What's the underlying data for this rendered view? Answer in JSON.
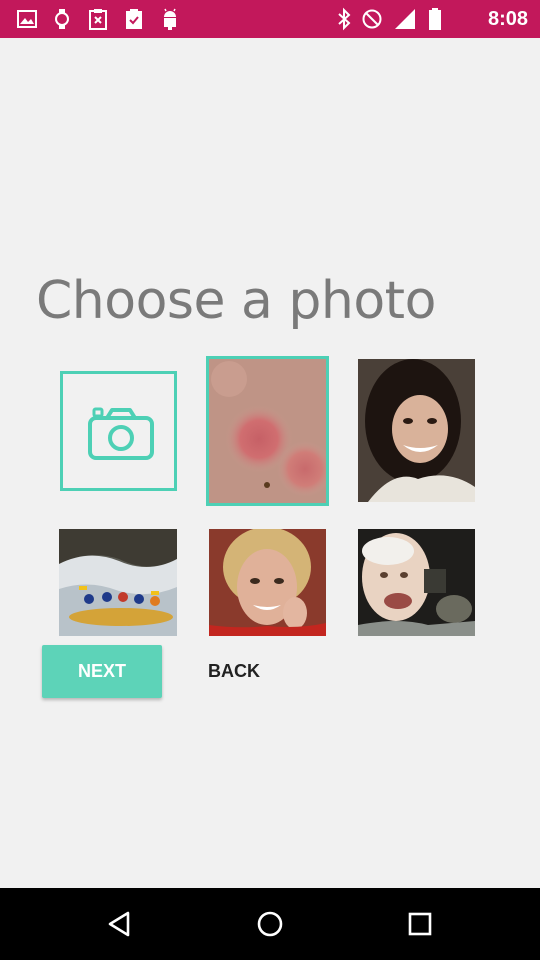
{
  "status_bar": {
    "time": "8:08",
    "color": "#c2185b",
    "left_icons": [
      "gallery-icon",
      "watch-icon",
      "clipboard-x-icon",
      "clipboard-check-icon",
      "android-icon"
    ],
    "right_icons": [
      "bluetooth-icon",
      "do-not-disturb-icon",
      "signal-icon",
      "battery-icon"
    ]
  },
  "main": {
    "title": "Choose a photo",
    "accent_color": "#4dd0b5",
    "photos": [
      {
        "name": "camera-tile",
        "icon": "camera-icon"
      },
      {
        "name": "skin-rash-photo",
        "selected": true
      },
      {
        "name": "smiling-woman-photo"
      },
      {
        "name": "rafting-photo"
      },
      {
        "name": "older-woman-photo"
      },
      {
        "name": "older-man-photo"
      }
    ],
    "next_label": "NEXT",
    "back_label": "BACK"
  },
  "nav_bar": {
    "icons": [
      "back-triangle-icon",
      "home-circle-icon",
      "recents-square-icon"
    ]
  }
}
